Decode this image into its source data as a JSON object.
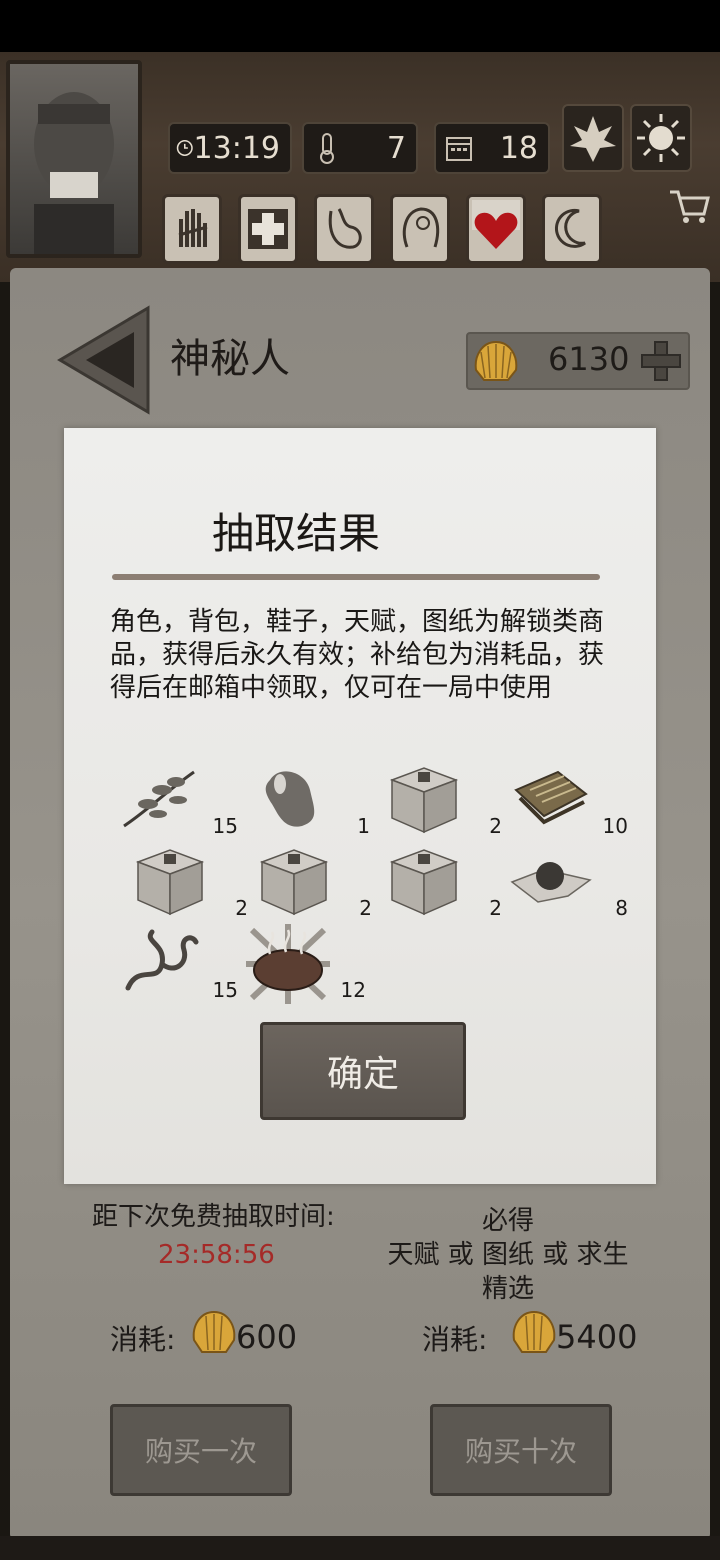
{
  "hud": {
    "time": "13:19",
    "temperature": "7",
    "day": "18",
    "season_icon": "leaf-icon",
    "weather_icon": "sun-icon",
    "cart_icon": "cart-icon",
    "stats": [
      "bandage-hand-icon",
      "plus-cross-icon",
      "stomach-icon",
      "head-icon",
      "heart-icon",
      "moon-icon"
    ]
  },
  "header": {
    "title": "神秘人",
    "coins": "6130"
  },
  "dialog": {
    "title": "抽取结果",
    "description": "角色，背包，鞋子，天赋，图纸为解锁类商品，获得后永久有效；补给包为消耗品，获得后在邮箱中领取，仅可在一局中使用",
    "items": [
      {
        "icon": "herb-branch-icon",
        "qty": "15"
      },
      {
        "icon": "bean-icon",
        "qty": "1"
      },
      {
        "icon": "box-icon",
        "qty": "2"
      },
      {
        "icon": "book-icon",
        "qty": "10"
      },
      {
        "icon": "box-icon",
        "qty": "2"
      },
      {
        "icon": "box-icon",
        "qty": "2"
      },
      {
        "icon": "box-icon",
        "qty": "2"
      },
      {
        "icon": "ball-cloth-icon",
        "qty": "8"
      },
      {
        "icon": "worm-icon",
        "qty": "15"
      },
      {
        "icon": "steak-icon",
        "qty": "12"
      }
    ],
    "confirm": "确定"
  },
  "footer": {
    "free_label": "距下次免费抽取时间:",
    "timer": "23:58:56",
    "guarantee_line1": "必得",
    "guarantee_line2": "天赋 或 图纸 或 求生精选",
    "cost_label": "消耗:",
    "cost_single": "600",
    "cost_ten": "5400",
    "buy_once": "购买一次",
    "buy_ten": "购买十次"
  },
  "colors": {
    "timer": "#a52a28"
  }
}
